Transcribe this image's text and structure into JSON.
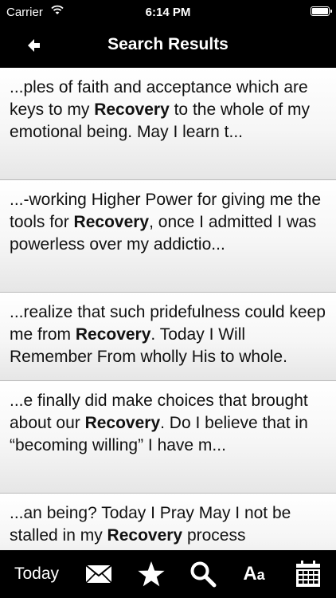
{
  "status": {
    "carrier": "Carrier",
    "time": "6:14 PM"
  },
  "nav": {
    "title": "Search Results"
  },
  "results": [
    {
      "before": "...ples of faith and acceptance which are keys to my ",
      "keyword": "Recovery",
      "after": " to the whole of my emotional being. May I learn t..."
    },
    {
      "before": "...-working Higher Power for giving me the tools for ",
      "keyword": "Recovery",
      "after": ", once I admitted I was powerless over my addictio..."
    },
    {
      "before": "...realize that such pridefulness could keep me from ",
      "keyword": "Recovery",
      "after": ". Today I Will Remember From wholly His to whole."
    },
    {
      "before": "...e finally did make choices that brought about our ",
      "keyword": "Recovery",
      "after": ". Do I believe that in “becoming willing” I have m..."
    },
    {
      "before": "...an being? Today I Pray May I not be stalled in my ",
      "keyword": "Recovery",
      "after": " process"
    }
  ],
  "tabs": {
    "today_label": "Today",
    "font_big": "A",
    "font_small": "a",
    "icons": [
      "envelope-icon",
      "star-icon",
      "magnifier-icon",
      "font-size-icon",
      "calendar-icon"
    ]
  }
}
